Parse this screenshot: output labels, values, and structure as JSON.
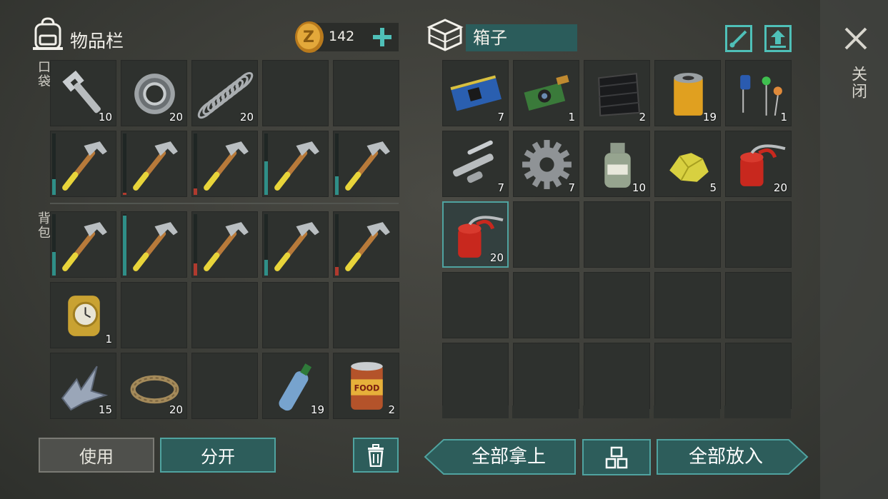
{
  "inventory": {
    "title": "物品栏",
    "coins": "142",
    "pocket_label": "口袋",
    "backpack_label": "背包",
    "pocket_slots": [
      {
        "item": "wrench",
        "count": "10"
      },
      {
        "item": "bearing",
        "count": "20"
      },
      {
        "item": "spring",
        "count": "20"
      },
      {
        "item": "",
        "count": ""
      },
      {
        "item": "",
        "count": ""
      },
      {
        "item": "hammer",
        "count": "",
        "durability": 0.26,
        "dur_color": "#2f8f88"
      },
      {
        "item": "hammer",
        "count": "",
        "durability": 0.04,
        "dur_color": "#b03a2e"
      },
      {
        "item": "hammer",
        "count": "",
        "durability": 0.1,
        "dur_color": "#b03a2e"
      },
      {
        "item": "hammer",
        "count": "",
        "durability": 0.55,
        "dur_color": "#2f8f88"
      },
      {
        "item": "hammer",
        "count": "",
        "durability": 0.3,
        "dur_color": "#2f8f88"
      }
    ],
    "backpack_slots": [
      {
        "item": "hammer",
        "count": "",
        "durability": 0.38,
        "dur_color": "#2f8f88"
      },
      {
        "item": "hammer",
        "count": "",
        "durability": 0.98,
        "dur_color": "#2f8f88"
      },
      {
        "item": "hammer",
        "count": "",
        "durability": 0.2,
        "dur_color": "#b03a2e"
      },
      {
        "item": "hammer",
        "count": "",
        "durability": 0.26,
        "dur_color": "#2f8f88"
      },
      {
        "item": "hammer",
        "count": "",
        "durability": 0.14,
        "dur_color": "#b03a2e"
      },
      {
        "item": "watch",
        "count": "1"
      },
      {
        "item": "",
        "count": ""
      },
      {
        "item": "",
        "count": ""
      },
      {
        "item": "",
        "count": ""
      },
      {
        "item": "",
        "count": ""
      },
      {
        "item": "scrap-metal",
        "count": "15"
      },
      {
        "item": "rope",
        "count": "20"
      },
      {
        "item": "",
        "count": ""
      },
      {
        "item": "water-bottle",
        "count": "19"
      },
      {
        "item": "food-can",
        "count": "2"
      }
    ],
    "use_label": "使用",
    "split_label": "分开"
  },
  "box": {
    "title": "箱子",
    "close_label": "关闭",
    "take_all_label": "全部拿上",
    "put_all_label": "全部放入",
    "slots": [
      {
        "item": "circuit-board",
        "count": "7"
      },
      {
        "item": "camera-module",
        "count": "1"
      },
      {
        "item": "carbon-fabric",
        "count": "2"
      },
      {
        "item": "oil-filter",
        "count": "19"
      },
      {
        "item": "electronic-components",
        "count": "1"
      },
      {
        "item": "metal-pipes",
        "count": "7"
      },
      {
        "item": "gear",
        "count": "7"
      },
      {
        "item": "chemical-jar",
        "count": "10"
      },
      {
        "item": "sulfur",
        "count": "5"
      },
      {
        "item": "oil-can",
        "count": "20"
      },
      {
        "item": "oil-can",
        "count": "20",
        "selected": true
      },
      {
        "item": "",
        "count": ""
      },
      {
        "item": "",
        "count": ""
      },
      {
        "item": "",
        "count": ""
      },
      {
        "item": "",
        "count": ""
      },
      {
        "item": "",
        "count": ""
      },
      {
        "item": "",
        "count": ""
      },
      {
        "item": "",
        "count": ""
      },
      {
        "item": "",
        "count": ""
      },
      {
        "item": "",
        "count": ""
      },
      {
        "item": "",
        "count": ""
      },
      {
        "item": "",
        "count": ""
      },
      {
        "item": "",
        "count": ""
      },
      {
        "item": "",
        "count": ""
      },
      {
        "item": "",
        "count": ""
      }
    ]
  },
  "colors": {
    "accent": "#4fa3a0",
    "accent_dark": "#2d5d5b",
    "coin": "#d79a2c"
  }
}
